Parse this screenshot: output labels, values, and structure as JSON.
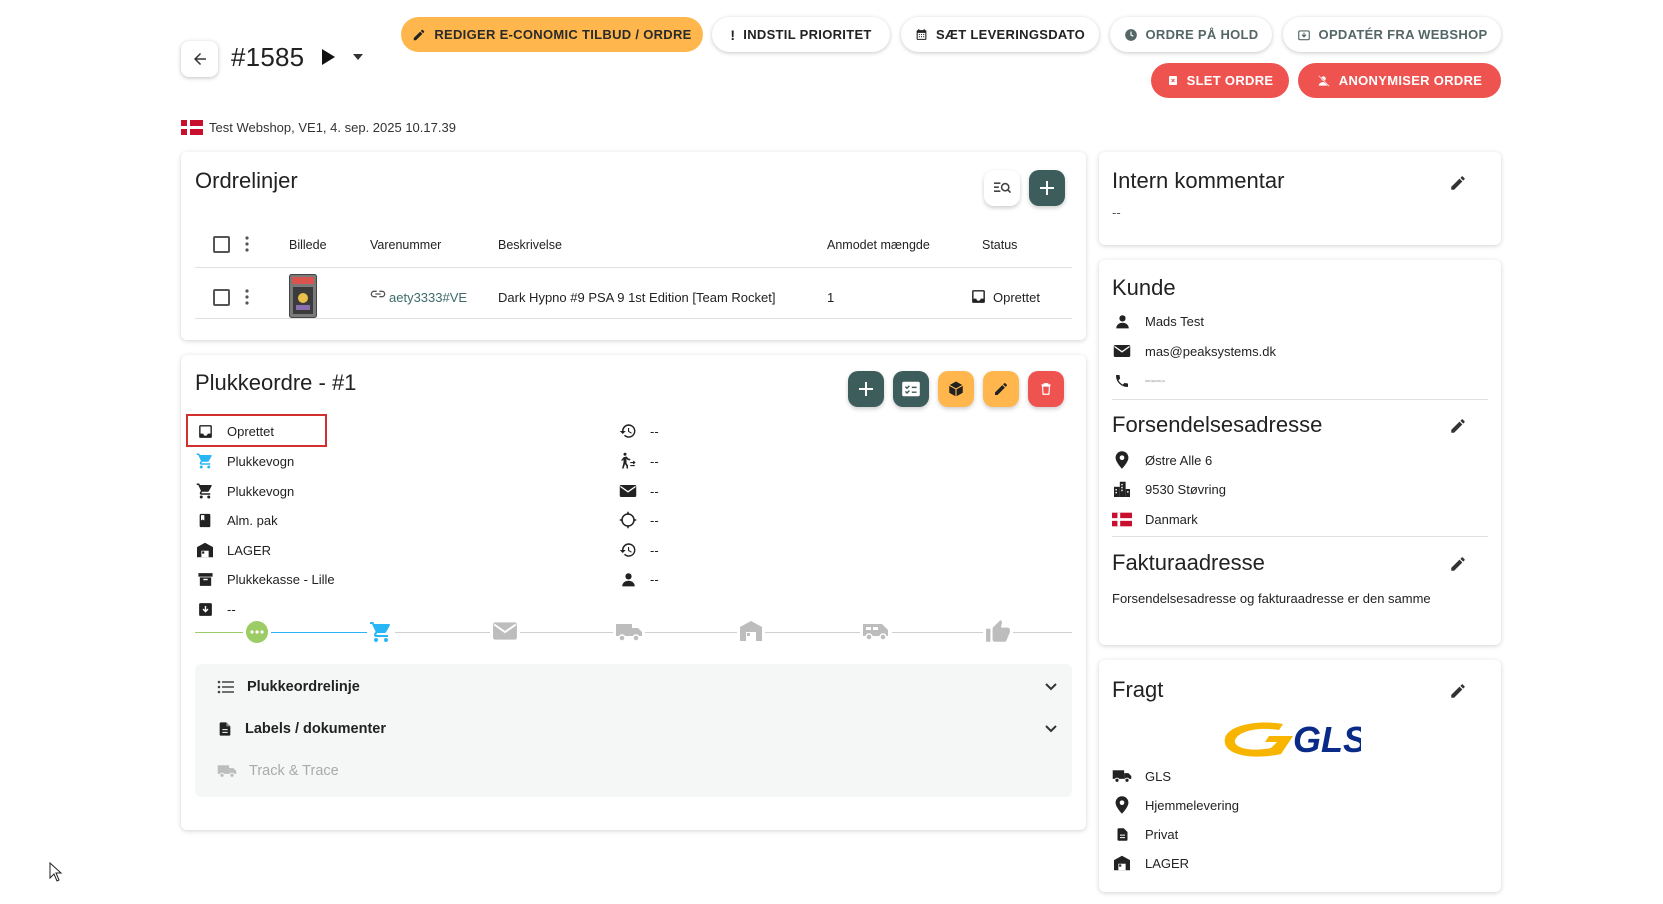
{
  "header": {
    "order_number": "#1585",
    "buttons": {
      "edit_economic": "REDIGER E-CONOMIC TILBUD / ORDRE",
      "set_priority": "INDSTIL PRIORITET",
      "set_delivery_date": "SÆT LEVERINGSDATO",
      "order_on_hold": "ORDRE PÅ HOLD",
      "update_from_webshop": "OPDATÉR FRA WEBSHOP",
      "delete_order": "SLET ORDRE",
      "anonymize_order": "ANONYMISER ORDRE"
    },
    "shop_info": "Test Webshop, VE1, 4. sep. 2025 10.17.39"
  },
  "order_lines": {
    "title": "Ordrelinjer",
    "columns": [
      "Billede",
      "Varenummer",
      "Beskrivelse",
      "Anmodet mængde",
      "Status"
    ],
    "rows": [
      {
        "sku": "aety3333#VE",
        "description": "Dark Hypno #9 PSA 9 1st Edition [Team Rocket]",
        "quantity": "1",
        "status": "Oprettet"
      }
    ]
  },
  "pick_order": {
    "title": "Plukkeordre - #1",
    "left_info": [
      "Oprettet",
      "Plukkevogn",
      "Plukkevogn",
      "Alm. pak",
      "LAGER",
      "Plukkekasse - Lille",
      "--"
    ],
    "right_info": [
      "--",
      "--",
      "--",
      "--",
      "--",
      "--"
    ],
    "accordions": {
      "lines": "Plukkeordrelinje",
      "labels": "Labels / dokumenter",
      "track": "Track & Trace"
    }
  },
  "internal_comment": {
    "title": "Intern kommentar",
    "value": "--"
  },
  "customer": {
    "title": "Kunde",
    "name": "Mads Test",
    "email": "mas@peaksystems.dk"
  },
  "shipping_address": {
    "title": "Forsendelsesadresse",
    "street": "Østre Alle 6",
    "city": "9530 Støvring",
    "country": "Danmark"
  },
  "billing_address": {
    "title": "Fakturaadresse",
    "note": "Forsendelsesadresse og fakturaadresse er den samme"
  },
  "freight": {
    "title": "Fragt",
    "carrier": "GLS",
    "delivery_type": "Hjemmelevering",
    "customer_type": "Privat",
    "warehouse": "LAGER"
  },
  "colors": {
    "accent_orange": "#ffb74d",
    "danger_red": "#ef5350",
    "teal": "#3d5c5c",
    "link_teal": "#3d6b6b",
    "step_done_green": "#9ccc65",
    "step_active_blue": "#29b6f6",
    "gls_yellow": "#f7b500",
    "gls_blue": "#0a2a87"
  }
}
